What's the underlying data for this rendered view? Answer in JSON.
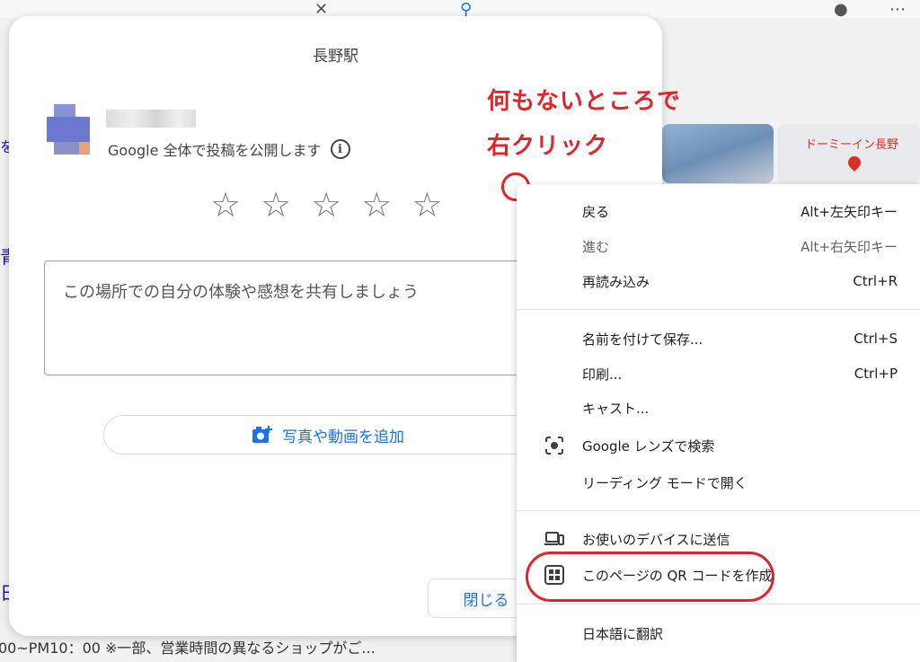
{
  "dialog": {
    "title": "長野駅",
    "post_note": "Google 全体で投稿を公開します",
    "rating_stars": [
      "☆",
      "☆",
      "☆",
      "☆",
      "☆"
    ],
    "review_placeholder": "この場所での自分の体験や感想を共有しましょう",
    "add_media_label": "写真や動画を追加",
    "close_label": "閉じる"
  },
  "annotation": {
    "line1": "何もないところで",
    "line2": "右クリック",
    "color": "#e0242c"
  },
  "context_menu": {
    "back": {
      "label": "戻る",
      "shortcut": "Alt+左矢印キー"
    },
    "forward": {
      "label": "進む",
      "shortcut": "Alt+右矢印キー"
    },
    "reload": {
      "label": "再読み込み",
      "shortcut": "Ctrl+R"
    },
    "save_as": {
      "label": "名前を付けて保存...",
      "shortcut": "Ctrl+S"
    },
    "print": {
      "label": "印刷...",
      "shortcut": "Ctrl+P"
    },
    "cast": {
      "label": "キャスト..."
    },
    "lens": {
      "label": "Google レンズで検索"
    },
    "reading_mode": {
      "label": "リーディング モードで開く"
    },
    "send_to_devices": {
      "label": "お使いのデバイスに送信"
    },
    "qr_code": {
      "label": "このページの QR コードを作成"
    },
    "translate": {
      "label": "日本語に翻訳"
    }
  },
  "background": {
    "map_tile_label": "ドーミーイン長野",
    "bottom_text": "00~PM10：00 ※一部、営業時間の異なるショップがご..."
  },
  "colors": {
    "accent": "#1a73e8",
    "annotation_red": "#e0242c"
  }
}
